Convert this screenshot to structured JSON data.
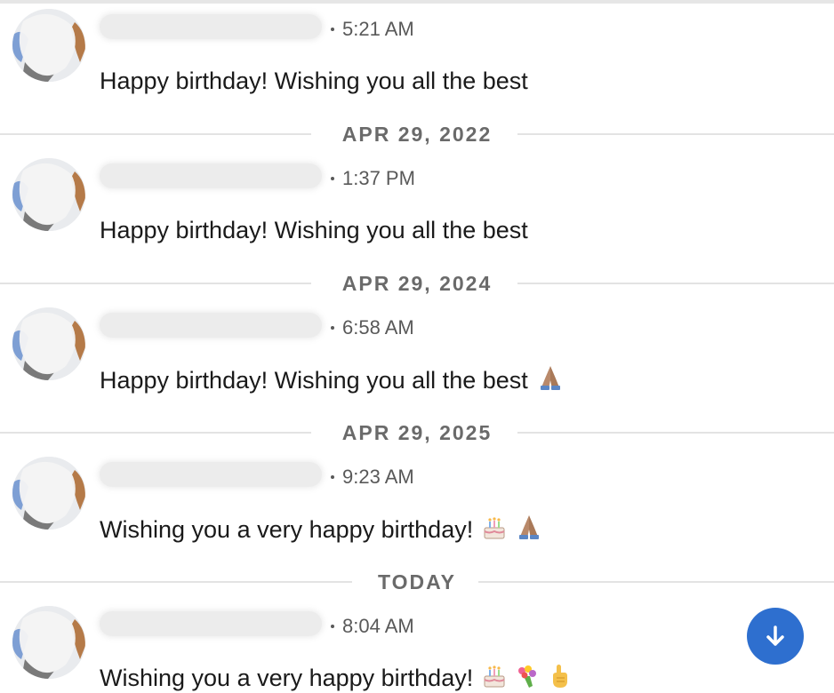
{
  "thread": {
    "messages": [
      {
        "time": "5:21 AM",
        "text": "Happy birthday! Wishing you all the best",
        "emojis": []
      },
      {
        "time": "1:37 PM",
        "text": "Happy birthday! Wishing you all the best",
        "emojis": []
      },
      {
        "time": "6:58 AM",
        "text": "Happy birthday! Wishing you all the best",
        "emojis": [
          "folded-hands"
        ]
      },
      {
        "time": "9:23 AM",
        "text": "Wishing you a very happy birthday!",
        "emojis": [
          "birthday-cake",
          "folded-hands"
        ]
      },
      {
        "time": "8:04 AM",
        "text": "Wishing you a very happy birthday!",
        "emojis": [
          "birthday-cake",
          "bouquet",
          "pointing-up-hand"
        ]
      }
    ],
    "dividers": [
      {
        "label": "APR 29, 2022"
      },
      {
        "label": "APR 29, 2024"
      },
      {
        "label": "APR 29, 2025"
      },
      {
        "label": "TODAY"
      }
    ]
  },
  "scroll_button": {
    "icon": "arrow-down-icon"
  },
  "colors": {
    "accent": "#2e6fcf",
    "divider": "#e3e3e3",
    "timestamp": "#595959",
    "redaction": "#ececec"
  }
}
